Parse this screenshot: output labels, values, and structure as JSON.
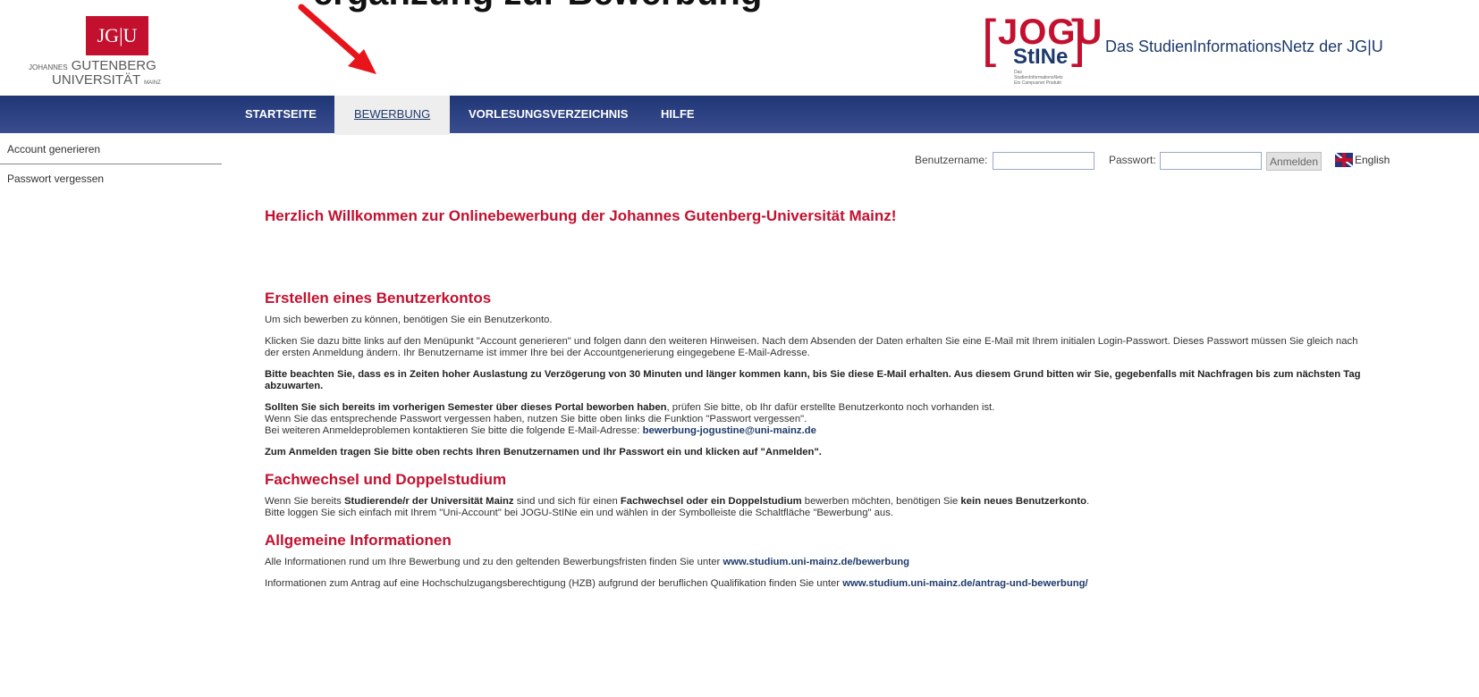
{
  "top_text": "ergänzung zur Bewerbung",
  "logo": {
    "box_text": "JG|U",
    "name_line1_small": "JOHANNES",
    "name_line1": "GUTENBERG",
    "name_line2": "UNIVERSITÄT",
    "name_line2_small": "MAINZ"
  },
  "jogu_logo": {
    "bracket_left": "[",
    "jogu": "JOGU",
    "bracket_right": "]",
    "stine": "StINe",
    "tiny_line1": "Das StudienInformationsNetz",
    "tiny_line2": "Ein Campusnet Produkt"
  },
  "site_title": "Das StudienInformationsNetz der JG|U",
  "nav": {
    "items": [
      "STARTSEITE",
      "BEWERBUNG",
      "VORLESUNGSVERZEICHNIS",
      "HILFE"
    ],
    "active": "BEWERBUNG"
  },
  "sidebar": {
    "items": [
      "Account generieren",
      "Passwort vergessen"
    ]
  },
  "login": {
    "username_label": "Benutzername:",
    "username_value": "",
    "password_label": "Passwort:",
    "password_value": "",
    "submit_label": "Anmelden",
    "language_label": "English"
  },
  "content": {
    "welcome": "Herzlich Willkommen zur Onlinebewerbung der Johannes Gutenberg-Universität Mainz!",
    "sec1": {
      "title": "Erstellen eines Benutzerkontos",
      "p1": "Um sich bewerben zu können, benötigen Sie ein Benutzerkonto.",
      "p2": "Klicken Sie dazu bitte links auf den Menüpunkt \"Account generieren\" und folgen dann den weiteren Hinweisen. Nach dem Absenden der Daten erhalten Sie eine E-Mail mit Ihrem initialen Login-Passwort. Dieses Passwort müssen Sie gleich nach der ersten Anmeldung ändern. Ihr Benutzername ist immer Ihre bei der Accountgenerierung eingegebene E-Mail-Adresse.",
      "p3": "Bitte beachten Sie, dass es in Zeiten hoher Auslastung zu Verzögerung von 30 Minuten und länger kommen kann, bis Sie diese E-Mail erhalten. Aus diesem Grund bitten wir Sie, gegebenfalls mit Nachfragen bis zum nächsten Tag abzuwarten.",
      "p4_bold": "Sollten Sie sich bereits im vorherigen Semester über dieses Portal beworben haben",
      "p4_rest": ", prüfen Sie bitte, ob Ihr dafür erstellte Benutzerkonto noch vorhanden ist.",
      "p4_line2": "Wenn Sie das entsprechende Passwort vergessen haben, nutzen Sie bitte oben links die Funktion \"Passwort vergessen\".",
      "p4_line3": "Bei weiteren Anmeldeproblemen kontaktieren Sie bitte die folgende E-Mail-Adresse: ",
      "p4_email": "bewerbung-jogustine@uni-mainz.de",
      "p5": "Zum Anmelden tragen Sie bitte oben rechts Ihren Benutzernamen und Ihr Passwort ein und klicken auf \"Anmelden\"."
    },
    "sec2": {
      "title": "Fachwechsel und Doppelstudium",
      "t1": "Wenn Sie bereits ",
      "b1": "Studierende/r der Universität Mainz",
      "t2": " sind und sich für einen ",
      "b2": "Fachwechsel oder ein Doppelstudium",
      "t3": " bewerben möchten, benötigen Sie ",
      "b3": "kein neues Benutzerkonto",
      "t4": ".",
      "line2": "Bitte loggen Sie sich einfach mit Ihrem \"Uni-Account\" bei JOGU-StINe ein und wählen in der Symbolleiste die Schaltfläche \"Bewerbung\" aus."
    },
    "sec3": {
      "title": "Allgemeine Informationen",
      "p1_text": "Alle Informationen rund um Ihre Bewerbung und zu den geltenden Bewerbungsfristen finden Sie unter ",
      "p1_link": "www.studium.uni-mainz.de/bewerbung",
      "p2_text": "Informationen zum Antrag auf eine Hochschulzugangsberechtigung (HZB) aufgrund der beruflichen Qualifikation finden Sie unter ",
      "p2_link": "www.studium.uni-mainz.de/antrag-und-bewerbung/"
    }
  },
  "colors": {
    "accent_red": "#c4102f",
    "nav_blue": "#2c3b7c",
    "link_blue": "#1e3a6b"
  }
}
